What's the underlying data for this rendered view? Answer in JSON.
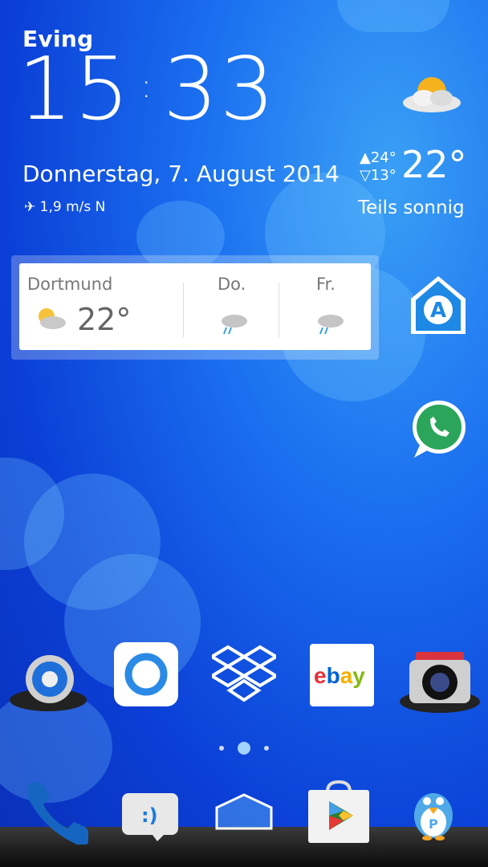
{
  "clock": {
    "location": "Eving",
    "hours": "15",
    "minutes": "33",
    "date": "Donnerstag, 7. August 2014",
    "wind": "1,9 m/s N"
  },
  "weather": {
    "high": "24°",
    "low": "13°",
    "current_temp": "22°",
    "condition": "Teils sonnig",
    "icon": "partly-sunny-icon"
  },
  "forecast_widget": {
    "city": "Dortmund",
    "temp": "22°",
    "days": [
      {
        "label": "Do.",
        "icon": "rain-cloud-icon"
      },
      {
        "label": "Fr.",
        "icon": "rain-cloud-icon"
      }
    ]
  },
  "right_apps": [
    {
      "name": "aqua-mail",
      "icon": "mail-at-icon"
    },
    {
      "name": "whatsapp",
      "icon": "phone-bubble-icon"
    }
  ],
  "home_apps": [
    {
      "name": "settings",
      "icon": "gear-icon"
    },
    {
      "name": "app-circle",
      "icon": "circle-ring-icon"
    },
    {
      "name": "dropbox",
      "icon": "dropbox-icon"
    },
    {
      "name": "ebay",
      "icon": "ebay-icon",
      "text": "ebay"
    },
    {
      "name": "camera",
      "icon": "camera-icon"
    }
  ],
  "page_indicator": {
    "pages": 3,
    "current": 2
  },
  "dock_apps": [
    {
      "name": "phone",
      "icon": "phone-icon"
    },
    {
      "name": "messaging",
      "icon": "message-icon"
    },
    {
      "name": "home",
      "icon": "home-icon"
    },
    {
      "name": "play-store",
      "icon": "play-store-icon"
    },
    {
      "name": "pingo",
      "icon": "penguin-icon"
    }
  ],
  "colors": {
    "background": "#1b6ff0",
    "ebay_red": "#e53238",
    "ebay_blue": "#0064d2",
    "ebay_yellow": "#f5af02",
    "ebay_green": "#86b817",
    "whatsapp": "#2aa34a",
    "dropbox": "#007ee5"
  }
}
